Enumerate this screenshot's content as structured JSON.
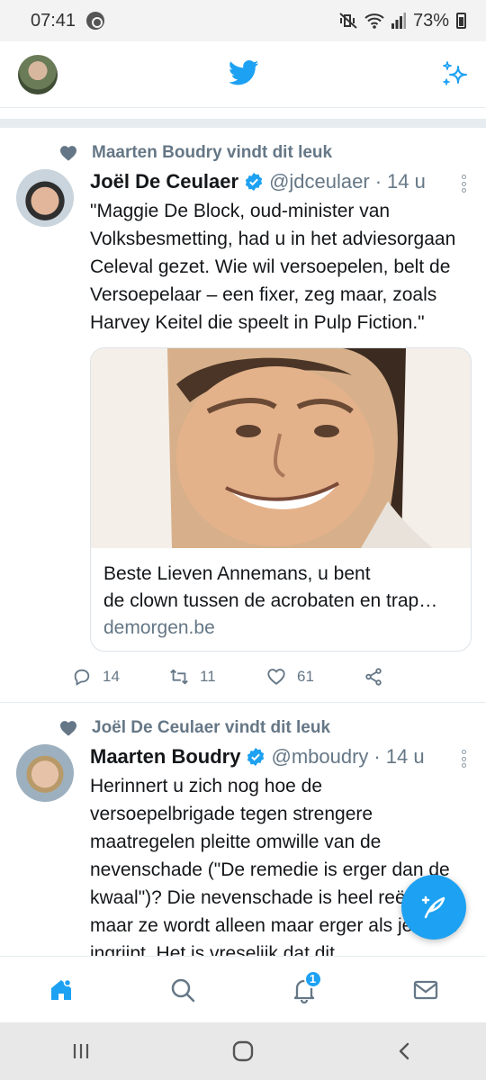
{
  "status_bar": {
    "time": "07:41",
    "battery": "73%"
  },
  "header": {
    "logo": "twitter-bird-icon",
    "sparkle": "sparkle-icon"
  },
  "tweets": [
    {
      "liked_by": "Maarten Boudry vindt dit leuk",
      "author": "Joël De Ceulaer",
      "handle": "@jdceulaer",
      "time": "14 u",
      "text": "\"Maggie De Block, oud-minister van Volksbesmetting, had u in het adviesorgaan Celeval gezet. Wie wil versoepelen, belt de Versoepelaar – een fixer, zeg maar, zoals Harvey Keitel die speelt in Pulp Fiction.\"",
      "card": {
        "title_line1": "Beste Lieven Annemans, u bent",
        "title_line2": "de clown tussen de acrobaten en trap…",
        "domain": "demorgen.be"
      },
      "replies": "14",
      "retweets": "11",
      "likes": "61"
    },
    {
      "liked_by": "Joël De Ceulaer vindt dit leuk",
      "author": "Maarten Boudry",
      "handle": "@mboudry",
      "time": "14 u",
      "text": "Herinnert u zich nog hoe de versoepelbrigade tegen strengere maatregelen pleitte omwille van de nevenschade (\"De remedie is erger dan de kwaal\")? Die nevenschade is heel reëel, maar ze wordt alleen maar erger als je NIET ingrijpt. Het is vreselijk dat dit"
    }
  ],
  "bottom_nav": {
    "notifications_badge": "1"
  },
  "colors": {
    "accent": "#1da1f2",
    "muted": "#657786",
    "text": "#14171a"
  }
}
